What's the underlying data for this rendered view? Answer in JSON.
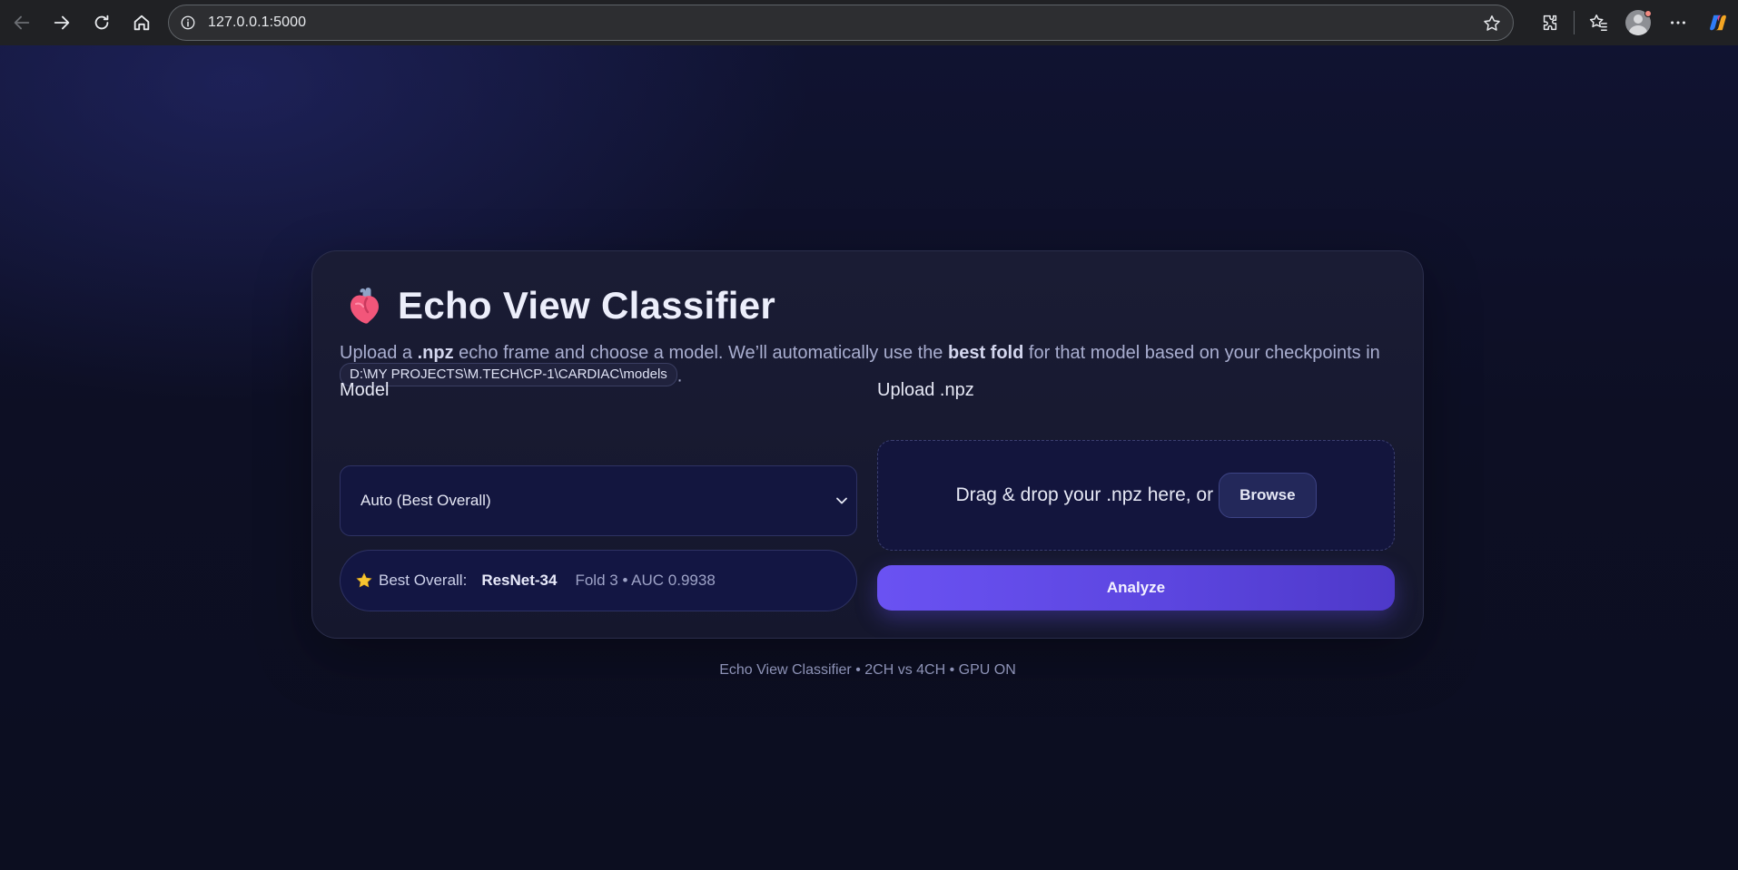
{
  "browser": {
    "url": "127.0.0.1:5000"
  },
  "card": {
    "title": "Echo View Classifier",
    "desc": {
      "p1": "Upload a ",
      "b1": ".npz",
      "p2": " echo frame and choose a model. We’ll automatically use the ",
      "b2": "best fold",
      "p3": " for that model based on your checkpoints in ",
      "path": "D:\\MY PROJECTS\\M.TECH\\CP-1\\CARDIAC\\models",
      "p4": "."
    },
    "model": {
      "label": "Model",
      "selected": "Auto (Best Overall)"
    },
    "best": {
      "label": "Best Overall:",
      "model": "ResNet-34",
      "meta": "Fold 3 • AUC 0.9938"
    },
    "upload": {
      "label": "Upload .npz",
      "drop_text": "Drag & drop your .npz here, or",
      "browse_label": "Browse"
    },
    "analyze_label": "Analyze"
  },
  "footer": "Echo View Classifier • 2CH vs 4CH • GPU ON",
  "colors": {
    "accent": "#6a52f2",
    "background": "#0d0f22"
  }
}
